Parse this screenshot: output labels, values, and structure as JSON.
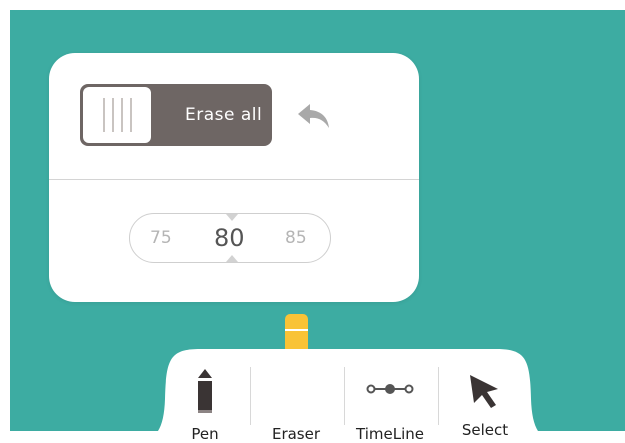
{
  "panel": {
    "erase_all_label": "Erase all",
    "size_slider": {
      "prev": "75",
      "current": "80",
      "next": "85"
    }
  },
  "toolbar": {
    "tools": [
      {
        "label": "Pen",
        "icon": "pen-icon"
      },
      {
        "label": "Eraser",
        "icon": "eraser-icon",
        "active": true
      },
      {
        "label": "TimeLine",
        "icon": "timeline-icon"
      },
      {
        "label": "Select",
        "icon": "cursor-arrow-icon"
      }
    ]
  },
  "colors": {
    "canvas": "#3daca2",
    "panel": "#ffffff",
    "button": "#6e6664",
    "eraser_accent": "#f9c336"
  }
}
